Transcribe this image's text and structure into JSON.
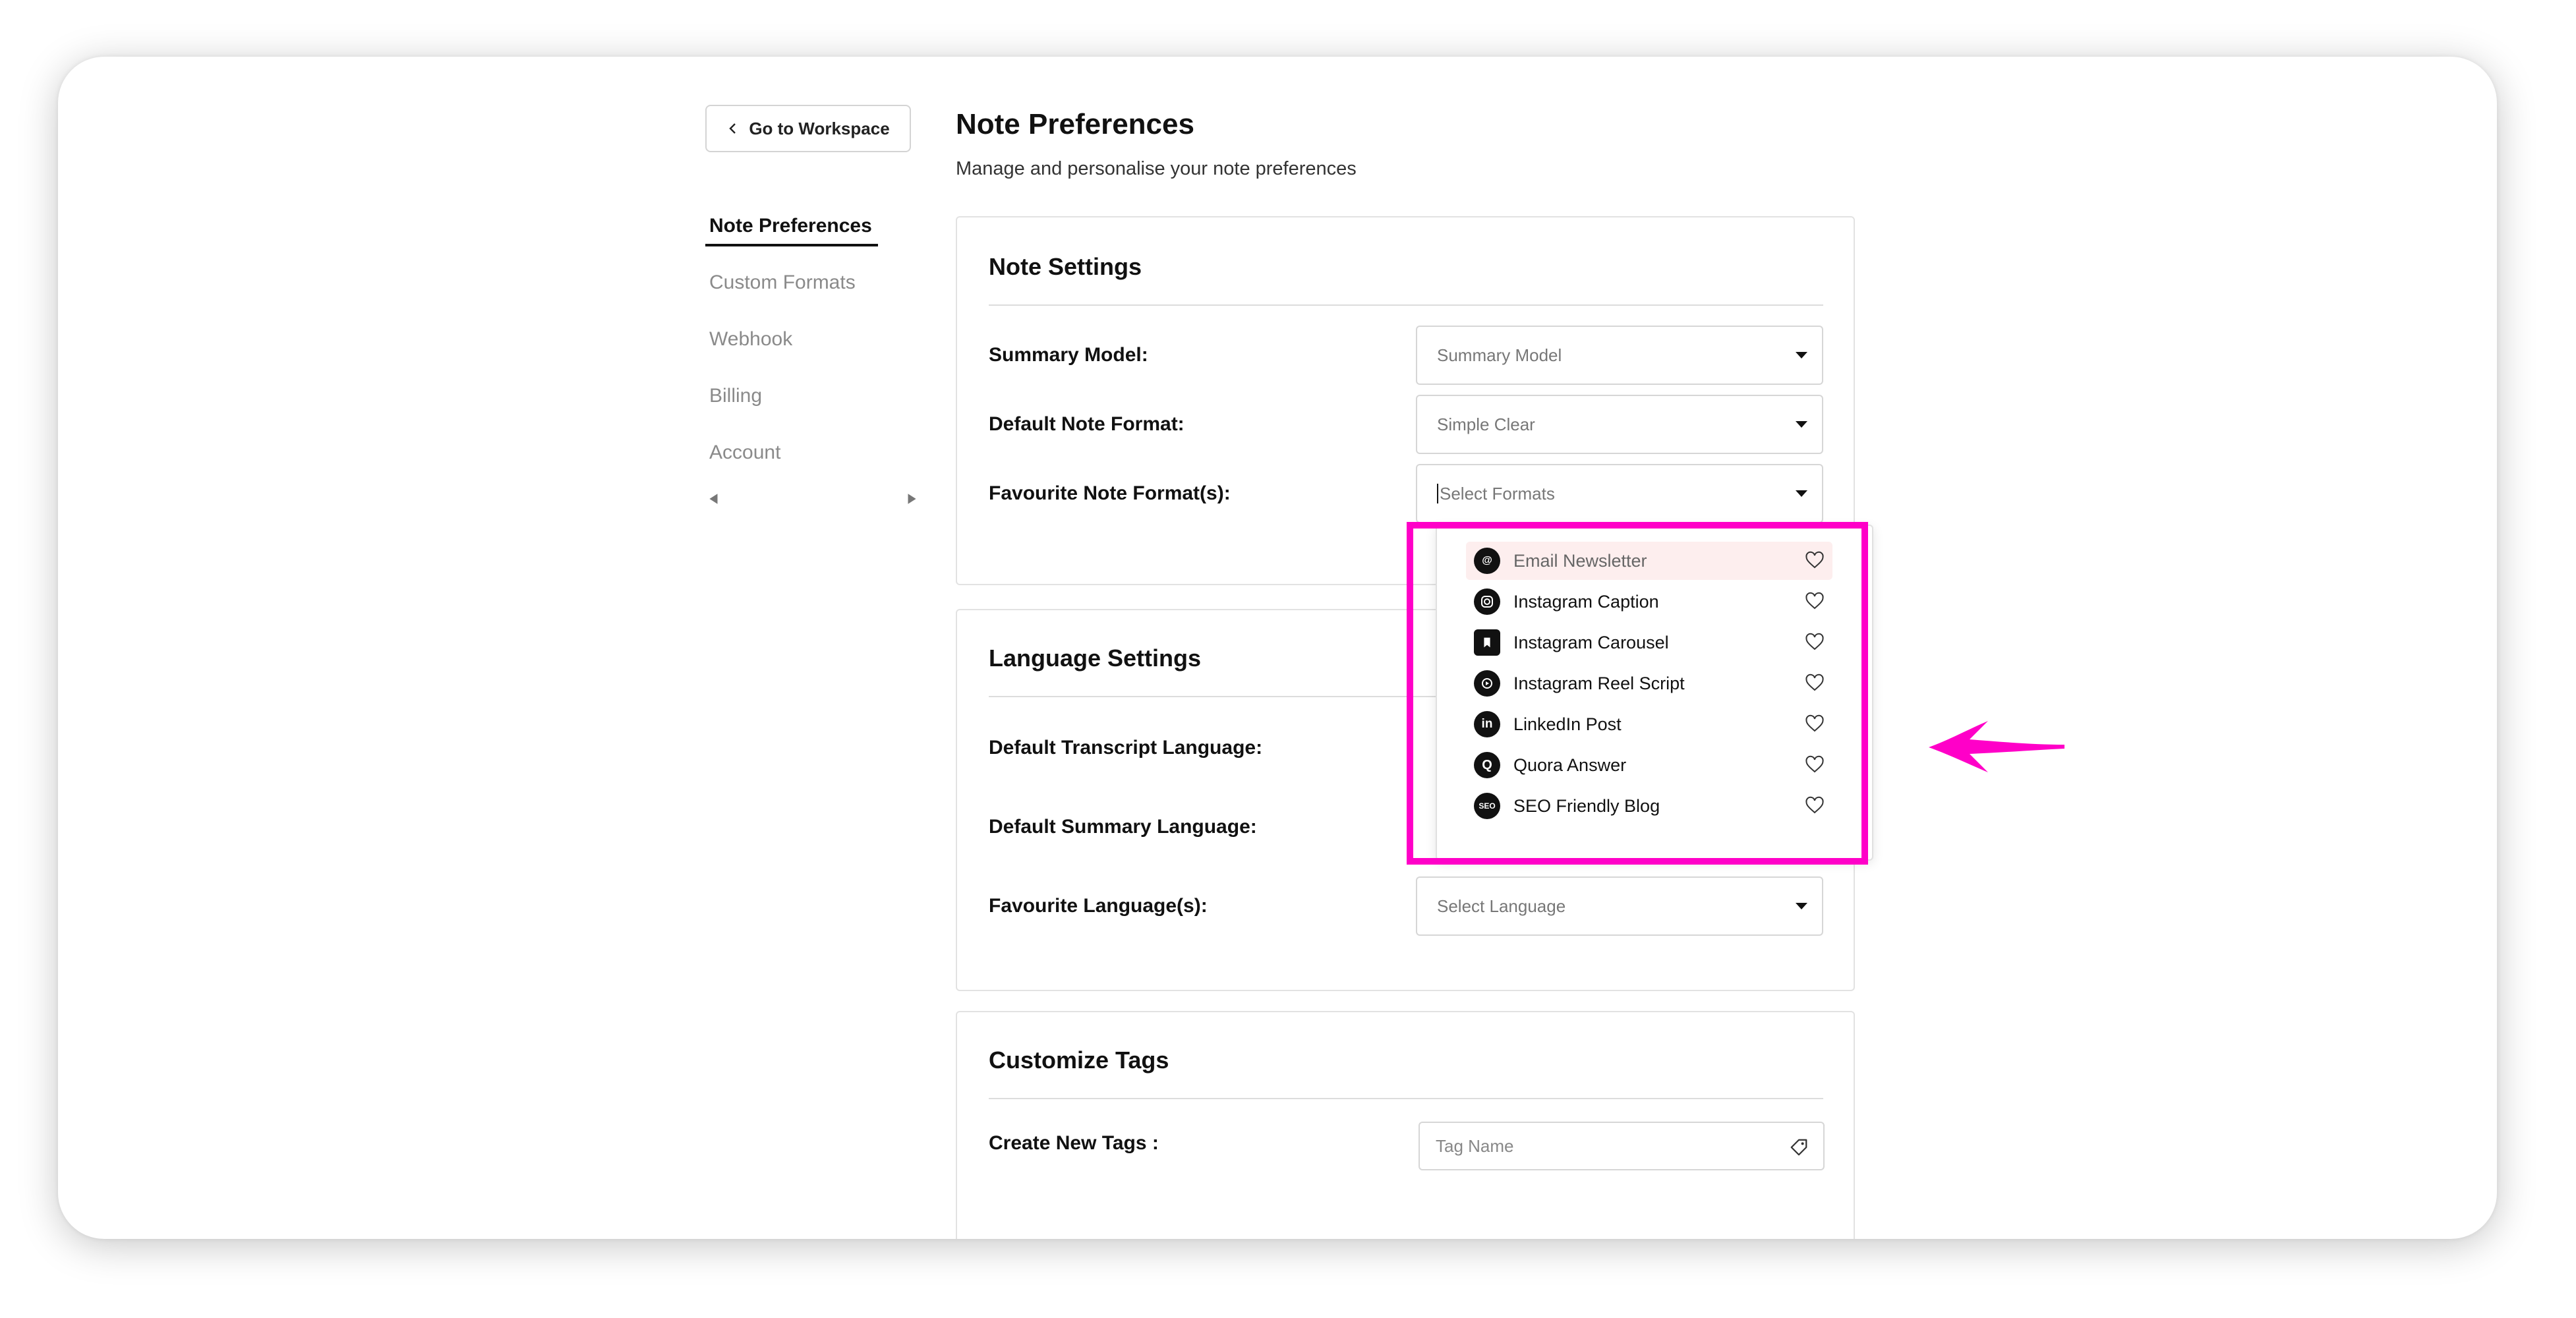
{
  "sidebar": {
    "back_label": "Go to Workspace",
    "items": [
      {
        "label": "Note Preferences",
        "active": true
      },
      {
        "label": "Custom Formats"
      },
      {
        "label": "Webhook"
      },
      {
        "label": "Billing"
      },
      {
        "label": "Account"
      }
    ]
  },
  "header": {
    "title": "Note Preferences",
    "subtitle": "Manage and personalise your note preferences"
  },
  "note_settings": {
    "title": "Note Settings",
    "summary_model": {
      "label": "Summary Model:",
      "value": "Summary Model"
    },
    "default_note_format": {
      "label": "Default Note Format:",
      "value": "Simple Clear"
    },
    "favourite_formats": {
      "label": "Favourite Note Format(s):",
      "placeholder": "Select Formats"
    }
  },
  "format_options": [
    {
      "label": "Email Newsletter",
      "icon": "at-icon"
    },
    {
      "label": "Instagram Caption",
      "icon": "instagram-icon"
    },
    {
      "label": "Instagram Carousel",
      "icon": "bookmark-icon"
    },
    {
      "label": "Instagram Reel Script",
      "icon": "reel-icon"
    },
    {
      "label": "LinkedIn Post",
      "icon": "linkedin-icon"
    },
    {
      "label": "Quora Answer",
      "icon": "quora-icon"
    },
    {
      "label": "SEO Friendly Blog",
      "icon": "seo-icon"
    }
  ],
  "language_settings": {
    "title": "Language Settings",
    "transcript_label": "Default Transcript Language:",
    "summary_label": "Default Summary Language:",
    "favourite_label": "Favourite Language(s):",
    "favourite_placeholder": "Select Language"
  },
  "tags": {
    "title": "Customize Tags",
    "create_label": "Create New Tags :",
    "placeholder": "Tag Name"
  },
  "colors": {
    "highlight": "#ff00c8",
    "hover_row": "#fdeeee"
  }
}
